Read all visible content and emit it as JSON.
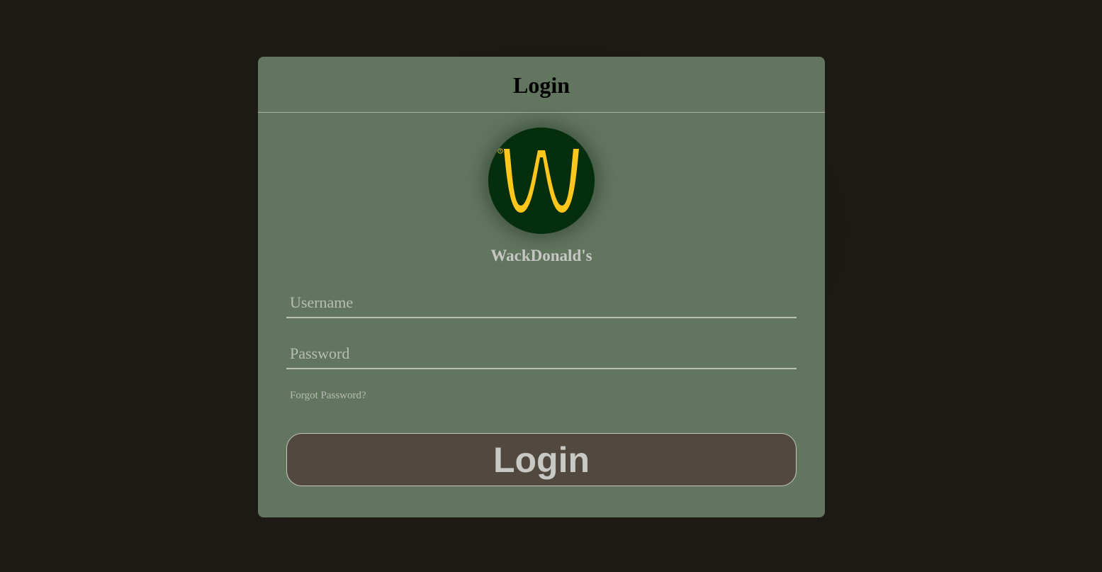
{
  "header": {
    "title": "Login"
  },
  "brand": {
    "name": "WackDonald's",
    "logo_letter": "W",
    "logo_mark": "®",
    "logo_bg_color": "#052e0c",
    "logo_fg_color": "#ffc61b"
  },
  "form": {
    "username_placeholder": "Username",
    "username_value": "",
    "password_placeholder": "Password",
    "password_value": "",
    "forgot_label": "Forgot Password?",
    "submit_label": "Login"
  },
  "colors": {
    "page_bg": "#1d1a14",
    "card_bg": "#61755f",
    "button_bg": "#51483f"
  }
}
